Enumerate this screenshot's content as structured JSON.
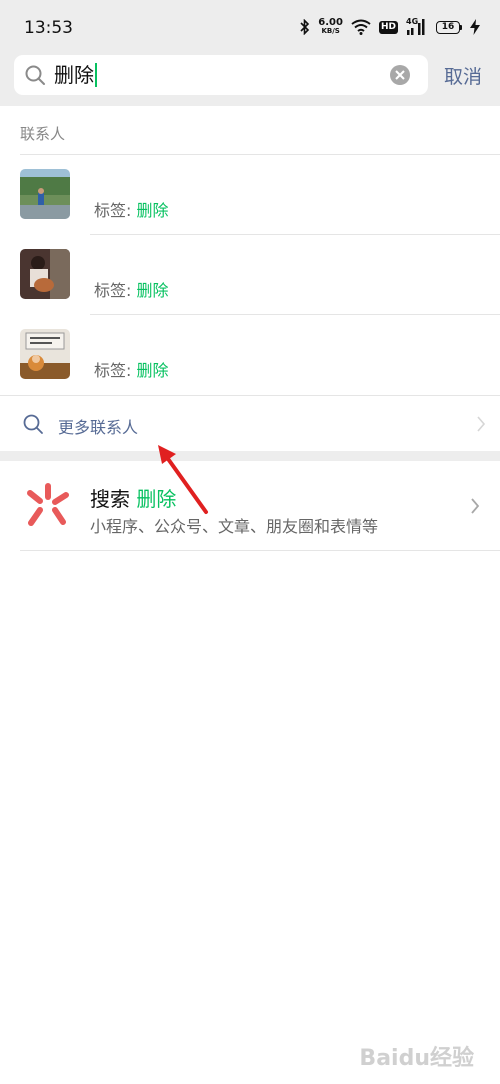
{
  "status_bar": {
    "time": "13:53",
    "net_speed_value": "6.00",
    "net_speed_unit": "KB/S",
    "hd_label": "HD",
    "network_type": "4G",
    "battery_level": "16",
    "icons": [
      "bluetooth-icon",
      "wifi-icon",
      "signal-icon",
      "charging-icon"
    ]
  },
  "search": {
    "query": "删除",
    "cancel_label": "取消"
  },
  "contacts": {
    "section_title": "联系人",
    "tag_prefix": "标签: ",
    "items": [
      {
        "tag": "删除"
      },
      {
        "tag": "删除"
      },
      {
        "tag": "删除"
      }
    ],
    "more_label": "更多联系人"
  },
  "search_entry": {
    "title": "搜索",
    "keyword": "删除",
    "description": "小程序、公众号、文章、朋友圈和表情等"
  },
  "watermark": "Baidu经验",
  "colors": {
    "accent_green": "#07c160",
    "link_blue": "#576b95",
    "background_gray": "#ededed",
    "annotation_red": "#e02020"
  }
}
